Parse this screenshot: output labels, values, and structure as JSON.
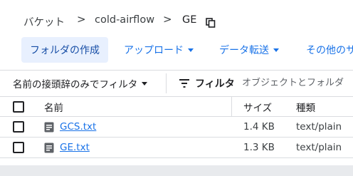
{
  "breadcrumb": {
    "items": [
      "バケット",
      "cold-airflow",
      "GE"
    ],
    "separator": ">",
    "copy_icon": "copy-icon"
  },
  "toolbar": {
    "create_folder": "フォルダの作成",
    "upload": "アップロード",
    "transfer": "データ転送",
    "other": "その他のサ"
  },
  "filter": {
    "prefix_label": "名前の接頭辞のみでフィルタ",
    "filter_label": "フィルタ",
    "placeholder": "オブジェクトとフォルダ"
  },
  "table": {
    "columns": [
      "名前",
      "サイズ",
      "種類"
    ],
    "rows": [
      {
        "name": "GCS.txt",
        "size": "1.4 KB",
        "type": "text/plain"
      },
      {
        "name": "GE.txt",
        "size": "1.3 KB",
        "type": "text/plain"
      }
    ]
  },
  "colors": {
    "accent": "#1a73e8",
    "primary_bg": "#e8f0fe",
    "divider": "#dadce0"
  }
}
